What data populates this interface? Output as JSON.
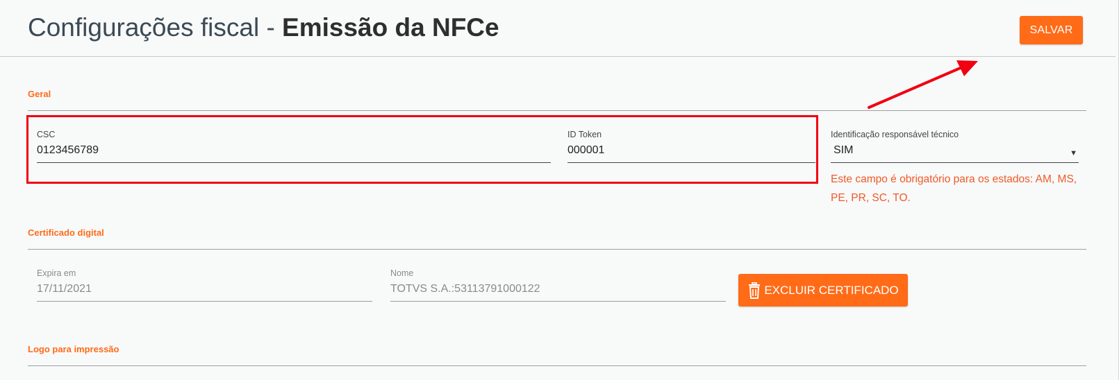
{
  "header": {
    "title_prefix": "Configurações fiscal - ",
    "title_bold": "Emissão da NFCe",
    "save_label": "SALVAR"
  },
  "sections": {
    "general": {
      "title": "Geral",
      "csc": {
        "label": "CSC",
        "value": "0123456789"
      },
      "id_token": {
        "label": "ID Token",
        "value": "000001"
      },
      "responsible": {
        "label": "Identificação responsável técnico",
        "value": "SIM",
        "hint": "Este campo é obrigatório para os estados: AM, MS, PE, PR, SC, TO."
      }
    },
    "certificate": {
      "title": "Certificado digital",
      "expires": {
        "label": "Expira em",
        "value": "17/11/2021"
      },
      "name": {
        "label": "Nome",
        "value": "TOTVS S.A.:53113791000122"
      },
      "delete_label": "EXCLUIR CERTIFICADO"
    },
    "logo": {
      "title": "Logo para impressão"
    }
  },
  "icons": {
    "delete": "trash-icon",
    "select": "caret-down-icon",
    "annotation": "arrow-annotation"
  },
  "colors": {
    "accent": "#ff6b17",
    "highlight": "#f00010",
    "hint": "#f05a28"
  }
}
